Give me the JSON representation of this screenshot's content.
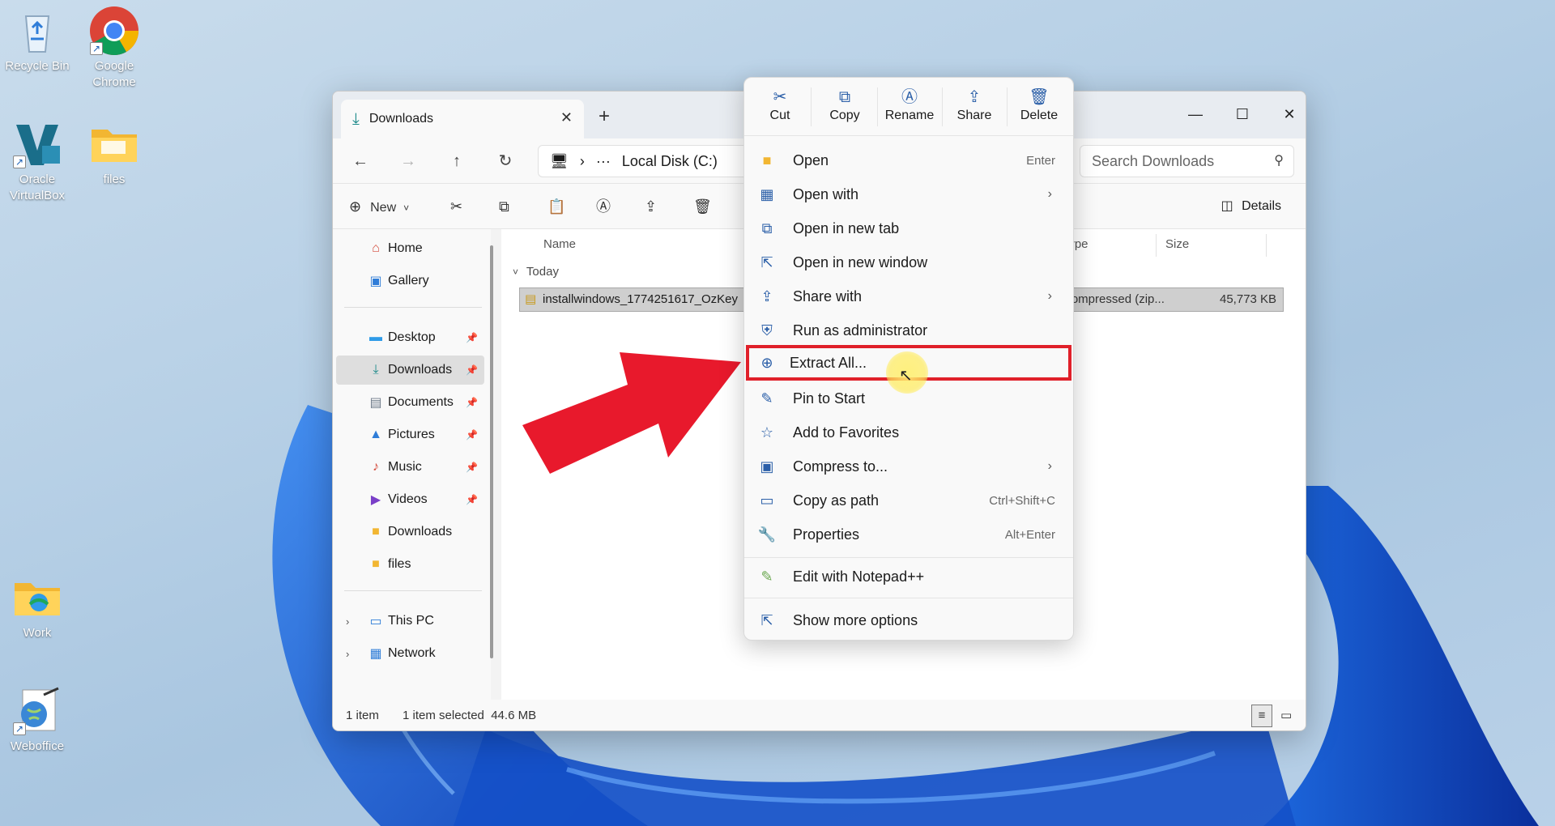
{
  "desktop": {
    "icons": [
      {
        "label": "Recycle Bin",
        "icon": "recycle-bin-icon"
      },
      {
        "label": "Google Chrome",
        "icon": "chrome-icon"
      },
      {
        "label": "Oracle VirtualBox",
        "icon": "virtualbox-icon"
      },
      {
        "label": "files",
        "icon": "folder-icon"
      },
      {
        "label": "Work",
        "icon": "folder-icon"
      },
      {
        "label": "Weboffice",
        "icon": "weboffice-icon"
      }
    ]
  },
  "window": {
    "tab_title": "Downloads",
    "address": {
      "segment": "Local Disk (C:)",
      "overflow": "···"
    },
    "search_placeholder": "Search Downloads",
    "toolbar": {
      "new_label": "New",
      "details_label": "Details"
    },
    "sidebar": {
      "items": [
        {
          "label": "Home",
          "icon": "home-icon"
        },
        {
          "label": "Gallery",
          "icon": "gallery-icon"
        },
        {
          "label": "Desktop",
          "icon": "desktop-icon",
          "pinned": true
        },
        {
          "label": "Downloads",
          "icon": "download-icon",
          "pinned": true,
          "selected": true
        },
        {
          "label": "Documents",
          "icon": "documents-icon",
          "pinned": true
        },
        {
          "label": "Pictures",
          "icon": "pictures-icon",
          "pinned": true
        },
        {
          "label": "Music",
          "icon": "music-icon",
          "pinned": true
        },
        {
          "label": "Videos",
          "icon": "videos-icon",
          "pinned": true
        },
        {
          "label": "Downloads",
          "icon": "folder-icon"
        },
        {
          "label": "files",
          "icon": "folder-icon"
        },
        {
          "label": "This PC",
          "icon": "pc-icon"
        },
        {
          "label": "Network",
          "icon": "network-icon"
        }
      ]
    },
    "columns": {
      "name": "Name",
      "type": "Type",
      "size": "Size"
    },
    "group_label": "Today",
    "file": {
      "name": "installwindows_1774251617_OzKey",
      "type": "Compressed (zip...",
      "size": "45,773 KB"
    },
    "status": {
      "count": "1 item",
      "selection": "1 item selected  44.6 MB"
    }
  },
  "context_menu": {
    "quick_actions": [
      {
        "label": "Cut",
        "icon": "cut-icon"
      },
      {
        "label": "Copy",
        "icon": "copy-icon"
      },
      {
        "label": "Rename",
        "icon": "rename-icon"
      },
      {
        "label": "Share",
        "icon": "share-icon"
      },
      {
        "label": "Delete",
        "icon": "delete-icon"
      }
    ],
    "items": [
      {
        "label": "Open",
        "shortcut": "Enter",
        "icon": "folder-open-icon"
      },
      {
        "label": "Open with",
        "submenu": true,
        "icon": "open-with-icon"
      },
      {
        "label": "Open in new tab",
        "icon": "new-tab-icon"
      },
      {
        "label": "Open in new window",
        "icon": "new-window-icon"
      },
      {
        "label": "Share with",
        "submenu": true,
        "icon": "share-with-icon"
      },
      {
        "label": "Run as administrator",
        "icon": "shield-icon"
      },
      {
        "label": "Extract All...",
        "icon": "extract-icon",
        "highlighted": true
      },
      {
        "label": "Pin to Start",
        "icon": "pin-icon"
      },
      {
        "label": "Add to Favorites",
        "icon": "star-icon"
      },
      {
        "label": "Compress to...",
        "submenu": true,
        "icon": "compress-icon"
      },
      {
        "label": "Copy as path",
        "shortcut": "Ctrl+Shift+C",
        "icon": "copy-path-icon"
      },
      {
        "label": "Properties",
        "shortcut": "Alt+Enter",
        "icon": "wrench-icon"
      },
      {
        "label": "Edit with Notepad++",
        "icon": "notepadpp-icon"
      },
      {
        "label": "Show more options",
        "icon": "more-options-icon"
      }
    ]
  },
  "colors": {
    "highlight_border": "#e0202a",
    "arrow": "#e8192c",
    "accent": "#1c8a8a"
  }
}
